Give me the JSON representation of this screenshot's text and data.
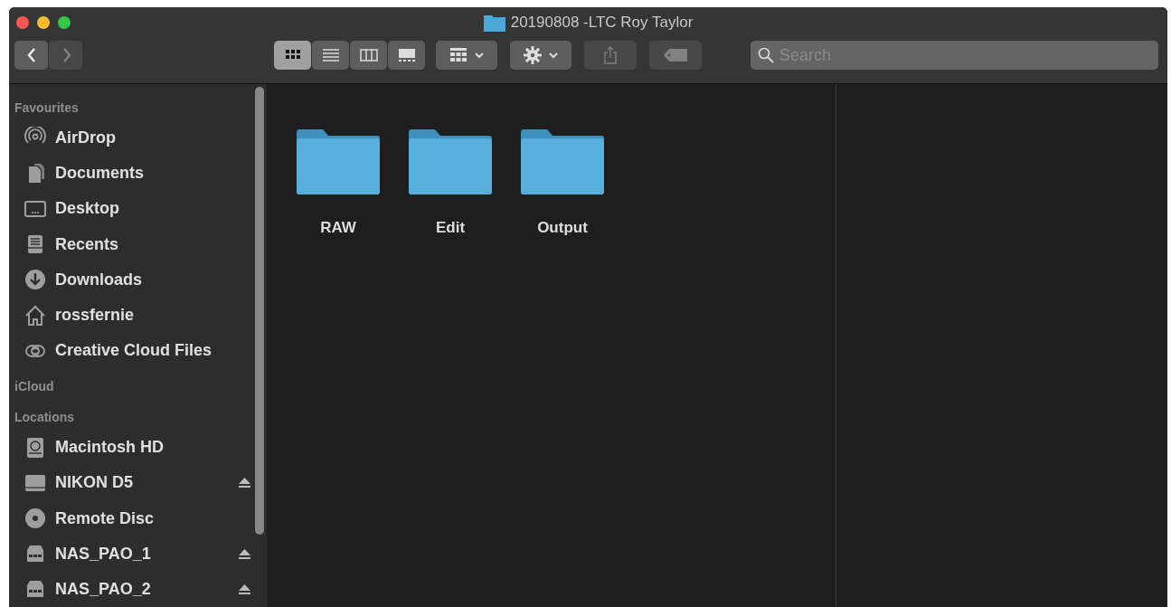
{
  "window": {
    "title": "20190808 -LTC Roy Taylor"
  },
  "toolbar": {
    "nav": [
      {
        "disabled": false
      },
      {
        "disabled": true
      }
    ],
    "view_buttons": [
      {
        "selected": true
      },
      {
        "selected": false
      },
      {
        "selected": false
      },
      {
        "selected": false
      }
    ],
    "share": {
      "disabled": true
    },
    "tags": {
      "disabled": true
    },
    "search": {
      "placeholder": "Search"
    }
  },
  "sidebar": {
    "sections": [
      {
        "title": "Favourites",
        "items": [
          {
            "label": "AirDrop",
            "eject": false
          },
          {
            "label": "Documents",
            "eject": false
          },
          {
            "label": "Desktop",
            "eject": false
          },
          {
            "label": "Recents",
            "eject": false
          },
          {
            "label": "Downloads",
            "eject": false
          },
          {
            "label": "rossfernie",
            "eject": false
          },
          {
            "label": "Creative Cloud Files",
            "eject": false
          }
        ]
      },
      {
        "title": "iCloud"
      },
      {
        "title": "Locations",
        "items": [
          {
            "label": "Macintosh HD",
            "eject": false
          },
          {
            "label": "NIKON D5",
            "eject": true
          },
          {
            "label": "Remote Disc",
            "eject": false
          },
          {
            "label": "NAS_PAO_1",
            "eject": true
          },
          {
            "label": "NAS_PAO_2",
            "eject": true
          }
        ]
      }
    ]
  },
  "files": [
    {
      "name": "RAW"
    },
    {
      "name": "Edit"
    },
    {
      "name": "Output"
    }
  ]
}
